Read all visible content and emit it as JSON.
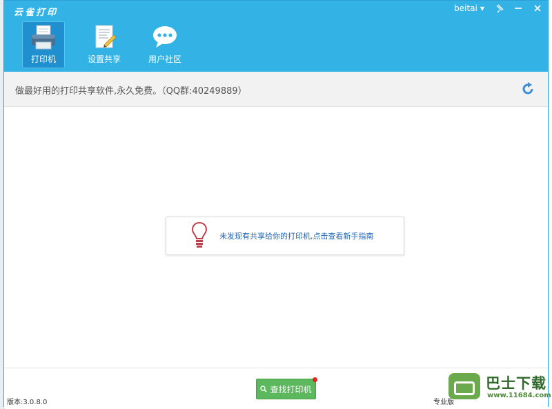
{
  "app": {
    "logo_text": "云雀打印",
    "user": "beitai"
  },
  "nav": {
    "items": [
      {
        "label": "打印机",
        "icon": "printer-icon",
        "active": true
      },
      {
        "label": "设置共享",
        "icon": "document-pen-icon",
        "active": false
      },
      {
        "label": "用户社区",
        "icon": "chat-bubble-icon",
        "active": false
      }
    ]
  },
  "subbar": {
    "slogan": "做最好用的打印共享软件,永久免费。（QQ群:40249889）"
  },
  "notice": {
    "message": "未发现有共享给你的打印机,点击查看新手指南"
  },
  "bottom": {
    "find_button": "查找打印机",
    "version": "版本:3.0.8.0",
    "edition": "专业版"
  },
  "watermark": {
    "brand": "巴士下载",
    "url": "www.11684.com"
  },
  "colors": {
    "header": "#33b2e6",
    "active_tab": "#1f8fd0",
    "button_green": "#5cb85c",
    "link_blue": "#1b66b8"
  }
}
